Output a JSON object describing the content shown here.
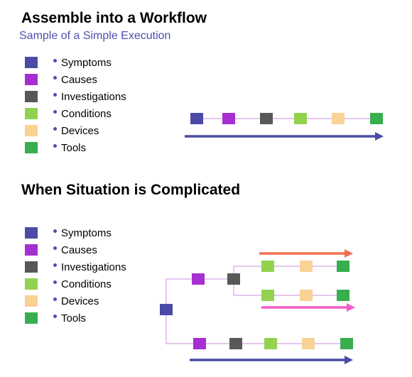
{
  "section1": {
    "title": "Assemble into a Workflow",
    "subtitle": "Sample of a Simple Execution"
  },
  "section2": {
    "title": "When Situation is Complicated"
  },
  "legend": [
    {
      "label": "Symptoms",
      "color": "#4b4ba6"
    },
    {
      "label": "Causes",
      "color": "#a52fd1"
    },
    {
      "label": "Investigations",
      "color": "#585858"
    },
    {
      "label": "Conditions",
      "color": "#93d24f"
    },
    {
      "label": "Devices",
      "color": "#f9d296"
    },
    {
      "label": "Tools",
      "color": "#38ae4e"
    }
  ],
  "colors": {
    "connector": "#ddb3ec",
    "arrow_main": "#4b4ba6",
    "arrow_orange": "#f36f4f",
    "arrow_pink": "#f25ac9"
  },
  "workflows": {
    "simple": [
      "Symptoms",
      "Causes",
      "Investigations",
      "Conditions",
      "Devices",
      "Tools"
    ],
    "branch_upper": [
      "Conditions",
      "Devices",
      "Tools"
    ],
    "branch_lower": [
      "Conditions",
      "Devices",
      "Tools"
    ],
    "bottom": [
      "Causes",
      "Investigations",
      "Conditions",
      "Devices",
      "Tools"
    ]
  }
}
